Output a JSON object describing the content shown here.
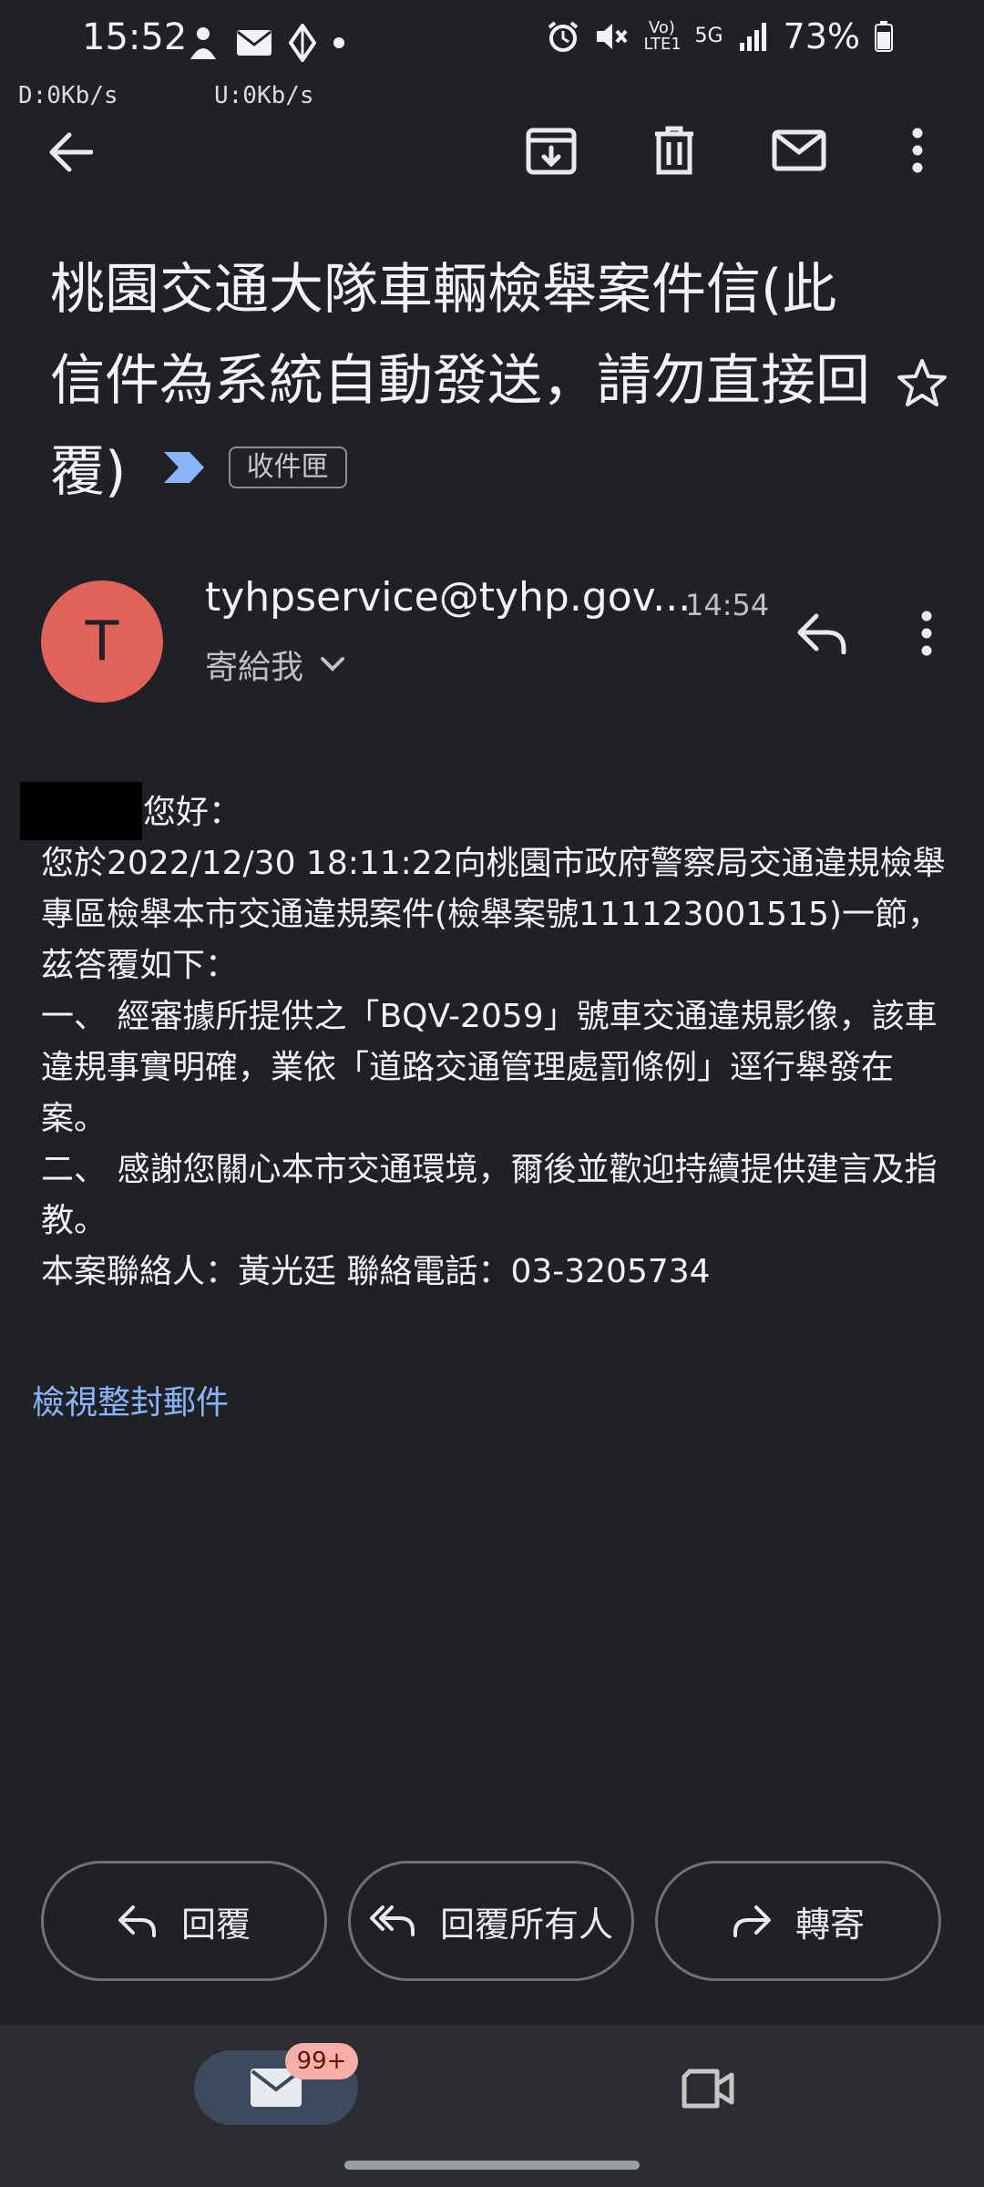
{
  "status_bar": {
    "time": "15:52",
    "battery": "73%",
    "volte": "Vo) LTE1",
    "network": "5G",
    "download": "D:0Kb/s",
    "upload": "U:0Kb/s"
  },
  "toolbar": {
    "back_icon": "arrow-left",
    "archive_icon": "archive",
    "delete_icon": "trash",
    "mark_unread_icon": "envelope",
    "more_icon": "more-vertical"
  },
  "email": {
    "subject": "桃園交通大隊車輛檢舉案件信(此信件為系統自動發送，請勿直接回覆)",
    "label": "收件匣",
    "sender_initial": "T",
    "sender": "tyhpservice@tyhp.gov...",
    "time": "14:54",
    "recipient": "寄給我",
    "body": {
      "greeting": "您好：",
      "line1": "您於2022/12/30 18:11:22向桃園市政府警察局交通違規檢舉專區檢舉本市交通違規案件(檢舉案號111123001515)一節，茲答覆如下：",
      "line2": "一、 經審據所提供之「BQV-2059」號車交通違規影像，該車違規事實明確，業依「道路交通管理處罰條例」逕行舉發在案。",
      "line3": "二、 感謝您關心本市交通環境，爾後並歡迎持續提供建言及指教。",
      "line4": "本案聯絡人：黃光廷 聯絡電話：03-3205734"
    },
    "view_full": "檢視整封郵件"
  },
  "actions": {
    "reply": "回覆",
    "reply_all": "回覆所有人",
    "forward": "轉寄"
  },
  "bottom_nav": {
    "mail_badge": "99+"
  },
  "colors": {
    "background": "#1f2125",
    "avatar": "#e0625b",
    "link": "#8ab4f8",
    "badge": "#f6aea9",
    "importance": "#8ab4f8"
  }
}
